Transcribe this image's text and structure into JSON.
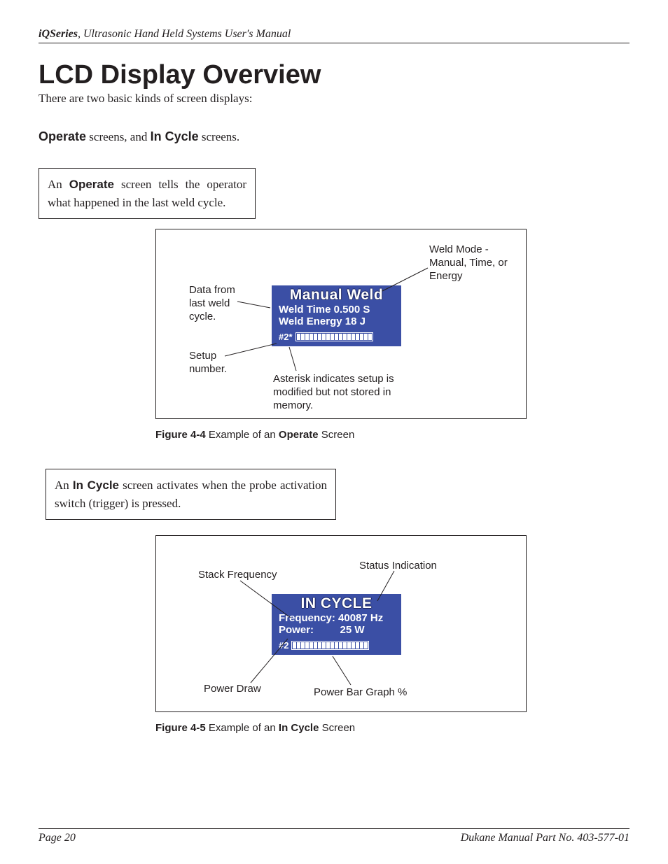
{
  "header": {
    "iq": "iQ",
    "series": " Series",
    "rest": ", Ultrasonic Hand Held Systems User's Manual"
  },
  "h1": "LCD Display Overview",
  "intro": "There are two basic kinds of screen displays:",
  "subhead": {
    "operate": "Operate",
    "mid": " screens, and ",
    "incycle": "In Cycle",
    "end": " screens."
  },
  "note1": {
    "pre": "An ",
    "bold": "Operate",
    "post": " screen tells the operator what happened in the last weld cycle."
  },
  "note2": {
    "pre": "An ",
    "bold": "In Cycle",
    "post": " screen activates when the probe activation switch (trigger) is pressed."
  },
  "fig1": {
    "lcd": {
      "title": "Manual Weld",
      "line1": "Weld Time 0.500 S",
      "line2": "Weld Energy 18 J",
      "setup": "#2*"
    },
    "ann": {
      "mode": "Weld Mode - Manual, Time, or Energy",
      "data": "Data from last weld cycle.",
      "setup": "Setup number.",
      "asterisk": "Asterisk indicates setup is modified but not stored in memory."
    },
    "caption": {
      "b1": "Figure 4-4",
      "mid": " Example of an ",
      "b2": "Operate",
      "end": " Screen"
    }
  },
  "fig2": {
    "lcd": {
      "title": "IN CYCLE",
      "line1": "Frequency: 40087 Hz",
      "line2": "Power:         25 W",
      "setup": "#2"
    },
    "ann": {
      "stack": "Stack Frequency",
      "status": "Status Indication",
      "power": "Power Draw",
      "bar": "Power Bar Graph %"
    },
    "caption": {
      "b1": "Figure 4-5",
      "mid": " Example of an ",
      "b2": "In Cycle",
      "end": " Screen"
    }
  },
  "footer": {
    "page": "Page    20",
    "part": "Dukane Manual Part No. 403-577-01"
  }
}
